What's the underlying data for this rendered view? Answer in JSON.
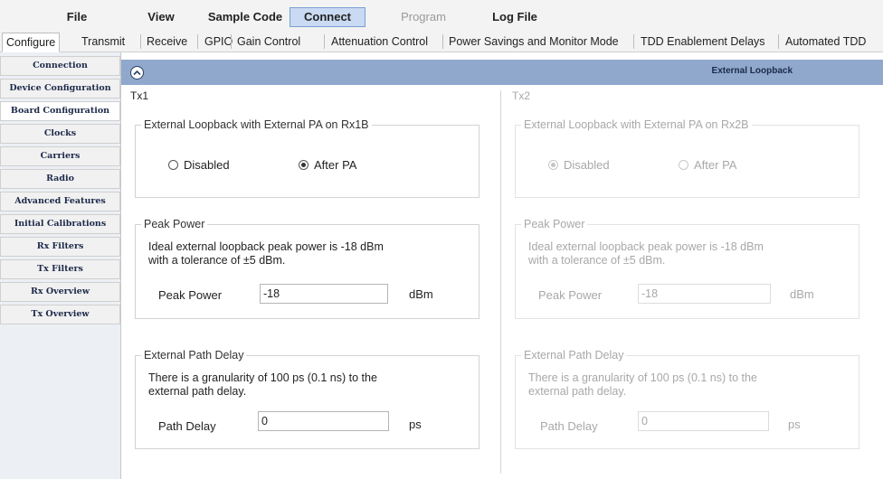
{
  "menu": [
    "File",
    "View",
    "Sample Code",
    "Connect",
    "Program",
    "Log File"
  ],
  "tabs": [
    "Configure",
    "Transmit",
    "Receive",
    "GPIO",
    "Gain Control",
    "Attenuation Control",
    "Power Savings and Monitor Mode",
    "TDD Enablement Delays",
    "Automated TDD"
  ],
  "sidebar": [
    "Connection",
    "Device Configuration",
    "Board Configuration",
    "Clocks",
    "Carriers",
    "Radio",
    "Advanced Features",
    "Initial Calibrations",
    "Rx Filters",
    "Tx Filters",
    "Rx Overview",
    "Tx Overview"
  ],
  "panel": {
    "title": "External Loopback"
  },
  "tx1": {
    "title": "Tx1",
    "loopback_group": "External Loopback with External PA on Rx1B",
    "option_disabled": "Disabled",
    "option_after_pa": "After PA",
    "selected": "after_pa",
    "peak_group": "Peak Power",
    "peak_desc_1": "Ideal external loopback peak power is -18 dBm",
    "peak_desc_2": "with a tolerance of ±5 dBm.",
    "peak_label": "Peak Power",
    "peak_value": "-18",
    "peak_unit": "dBm",
    "delay_group": "External Path Delay",
    "delay_desc_1": "There is a granularity of 100 ps (0.1 ns) to the",
    "delay_desc_2": "external path delay.",
    "delay_label": "Path Delay",
    "delay_value": "0",
    "delay_unit": "ps"
  },
  "tx2": {
    "title": "Tx2",
    "loopback_group": "External Loopback with External PA on Rx2B",
    "option_disabled": "Disabled",
    "option_after_pa": "After PA",
    "selected": "disabled",
    "peak_group": "Peak Power",
    "peak_desc_1": "Ideal external loopback peak power is -18 dBm",
    "peak_desc_2": "with a tolerance of ±5 dBm.",
    "peak_label": "Peak Power",
    "peak_value": "-18",
    "peak_unit": "dBm",
    "delay_group": "External Path Delay",
    "delay_desc_1": "There is a granularity of 100 ps (0.1 ns) to the",
    "delay_desc_2": "external path delay.",
    "delay_label": "Path Delay",
    "delay_value": "0",
    "delay_unit": "ps"
  },
  "colors": {
    "header": "#8fa8cc",
    "active_menu": "#c9daf2",
    "sidebar_text": "#1d2a4a"
  },
  "icons": {
    "collapse": "chevron-up-circle-icon"
  }
}
